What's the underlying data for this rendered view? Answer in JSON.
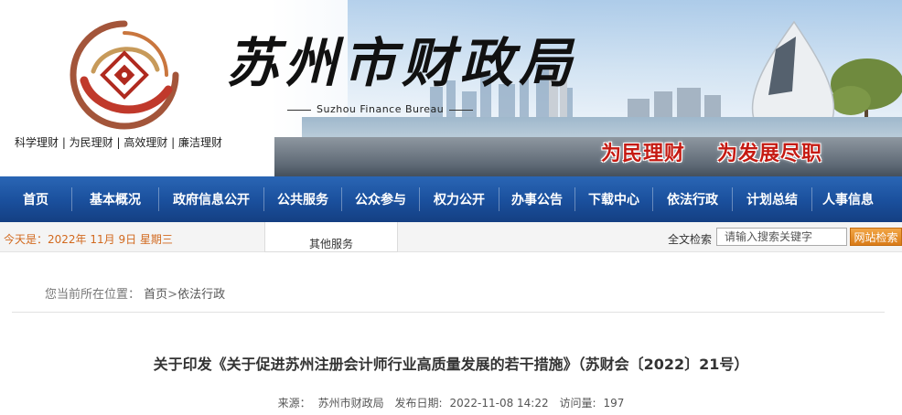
{
  "header": {
    "site_title": "苏州市财政局",
    "site_subtitle": "Suzhou Finance Bureau",
    "slogan": "科学理财 | 为民理财 | 高效理财 | 廉洁理财",
    "banner_slogans": [
      "为民理财",
      "为发展尽职"
    ]
  },
  "nav": {
    "items": [
      {
        "label": "首页"
      },
      {
        "label": "基本概况"
      },
      {
        "label": "政府信息公开"
      },
      {
        "label": "公共服务"
      },
      {
        "label": "公众参与"
      },
      {
        "label": "权力公开"
      },
      {
        "label": "办事公告"
      },
      {
        "label": "下载中心"
      },
      {
        "label": "依法行政"
      },
      {
        "label": "计划总结"
      },
      {
        "label": "人事信息"
      }
    ]
  },
  "infobar": {
    "date": "今天是：2022年 11月 9日 星期三",
    "other_services": "其他服务",
    "search_label": "全文检索",
    "search_placeholder": "请输入搜索关键字",
    "search_button": "网站检索"
  },
  "breadcrumb": {
    "prefix": "您当前所在位置：",
    "home": "首页",
    "separator": ">",
    "current": "依法行政"
  },
  "article": {
    "title": "关于印发《关于促进苏州注册会计师行业高质量发展的若干措施》（苏财会〔2022〕21号）",
    "source_label": "来源：",
    "source": "苏州市财政局",
    "date_label": "发布日期:",
    "date": "2022-11-08 14:22",
    "views_label": "访问量:",
    "views": "197"
  },
  "colors": {
    "nav_blue": "#1a4f9c",
    "date_orange": "#d2691e",
    "search_button": "#e08a24",
    "slogan_red": "#c51a12"
  }
}
